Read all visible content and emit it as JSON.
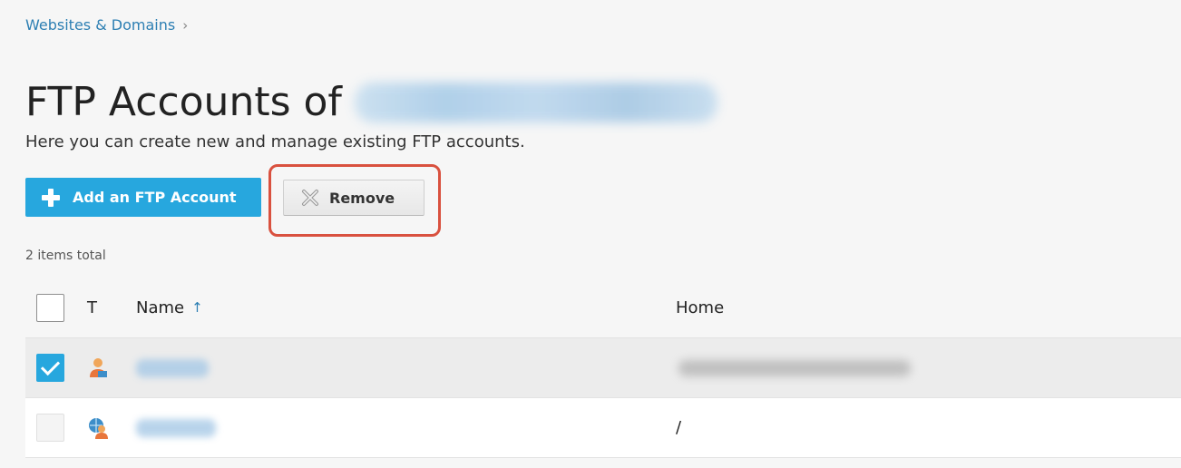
{
  "breadcrumb": {
    "link": "Websites & Domains",
    "separator": "›"
  },
  "page": {
    "title": "FTP Accounts of",
    "description": "Here you can create new and manage existing FTP accounts."
  },
  "toolbar": {
    "add_label": "Add an FTP Account",
    "remove_label": "Remove"
  },
  "list": {
    "count_text": "2 items total",
    "columns": {
      "type": "T",
      "name": "Name",
      "name_sort": "↑",
      "home": "Home"
    },
    "rows": [
      {
        "checked": true,
        "home": "",
        "icon": "ftp-user-icon"
      },
      {
        "checked": false,
        "home": "/",
        "icon": "ftp-web-user-icon"
      }
    ]
  },
  "colors": {
    "accent": "#27a7de",
    "link": "#2d7fb3",
    "highlight": "#d9513f"
  },
  "icons": [
    "plus-icon",
    "remove-x-icon",
    "sort-up-icon",
    "chevron-right-icon"
  ]
}
